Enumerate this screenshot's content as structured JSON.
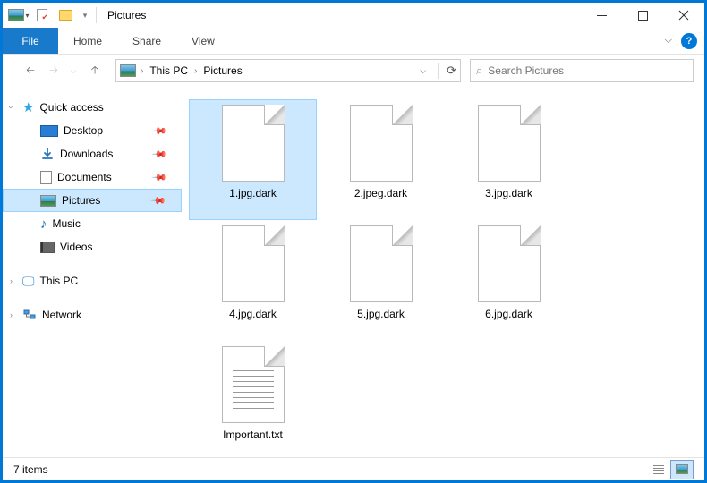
{
  "window": {
    "title": "Pictures"
  },
  "ribbon": {
    "file": "File",
    "tabs": [
      "Home",
      "Share",
      "View"
    ]
  },
  "breadcrumb": {
    "root": "This PC",
    "folder": "Pictures"
  },
  "search": {
    "placeholder": "Search Pictures"
  },
  "sidebar": {
    "quick": {
      "label": "Quick access",
      "items": [
        {
          "label": "Desktop",
          "icon": "desktop",
          "pinned": true
        },
        {
          "label": "Downloads",
          "icon": "downloads",
          "pinned": true
        },
        {
          "label": "Documents",
          "icon": "doc",
          "pinned": true
        },
        {
          "label": "Pictures",
          "icon": "pic",
          "pinned": true,
          "selected": true
        },
        {
          "label": "Music",
          "icon": "music"
        },
        {
          "label": "Videos",
          "icon": "video"
        }
      ]
    },
    "thispc": {
      "label": "This PC"
    },
    "network": {
      "label": "Network"
    }
  },
  "files": [
    {
      "name": "1.jpg.dark",
      "type": "blank",
      "selected": true
    },
    {
      "name": "2.jpeg.dark",
      "type": "blank"
    },
    {
      "name": "3.jpg.dark",
      "type": "blank"
    },
    {
      "name": "4.jpg.dark",
      "type": "blank"
    },
    {
      "name": "5.jpg.dark",
      "type": "blank"
    },
    {
      "name": "6.jpg.dark",
      "type": "blank"
    },
    {
      "name": "Important.txt",
      "type": "txt"
    }
  ],
  "status": {
    "count": "7 items"
  }
}
